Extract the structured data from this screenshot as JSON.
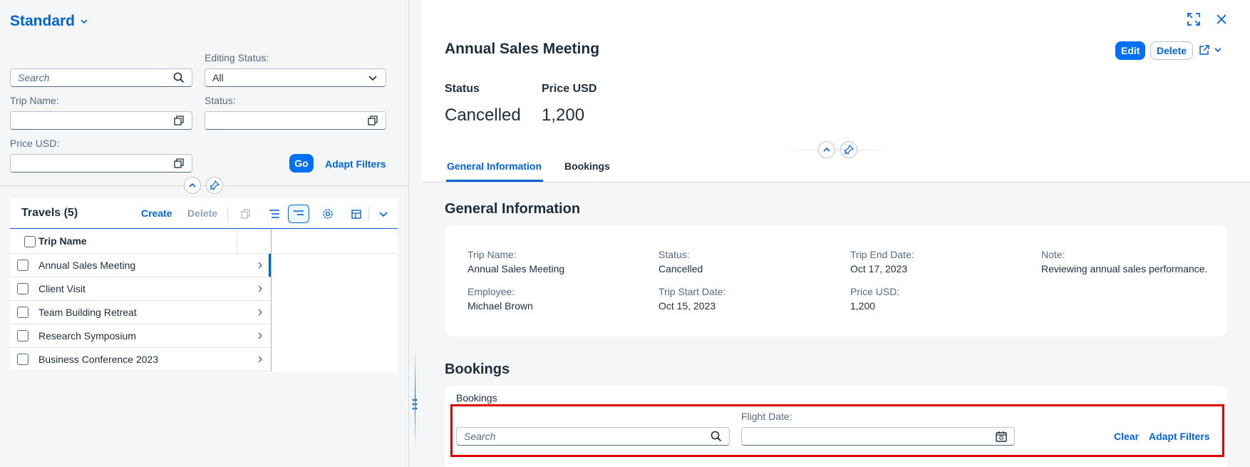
{
  "left": {
    "variant_title": "Standard",
    "filters": {
      "search_placeholder": "Search",
      "editing_status_label": "Editing Status:",
      "editing_status_value": "All",
      "trip_name_label": "Trip Name:",
      "status_label": "Status:",
      "price_label": "Price USD:",
      "go_label": "Go",
      "adapt_filters_label": "Adapt Filters"
    },
    "table": {
      "title": "Travels (5)",
      "create_label": "Create",
      "delete_label": "Delete",
      "column_header": "Trip Name",
      "rows": [
        "Annual Sales Meeting",
        "Client Visit",
        "Team Building Retreat",
        "Research Symposium",
        "Business Conference 2023"
      ]
    }
  },
  "right": {
    "object_title": "Annual Sales Meeting",
    "edit_label": "Edit",
    "delete_label": "Delete",
    "kpis": [
      {
        "label": "Status",
        "value": "Cancelled"
      },
      {
        "label": "Price USD",
        "value": "1,200"
      }
    ],
    "tabs": [
      "General Information",
      "Bookings"
    ],
    "general_info": {
      "title": "General Information",
      "fields": [
        {
          "label": "Trip Name:",
          "value": "Annual Sales Meeting"
        },
        {
          "label": "Status:",
          "value": "Cancelled"
        },
        {
          "label": "Trip End Date:",
          "value": "Oct 17, 2023"
        },
        {
          "label": "Note:",
          "value": "Reviewing annual sales performance."
        },
        {
          "label": "Employee:",
          "value": "Michael Brown"
        },
        {
          "label": "Trip Start Date:",
          "value": "Oct 15, 2023"
        },
        {
          "label": "Price USD:",
          "value": "1,200"
        }
      ]
    },
    "bookings": {
      "section_title": "Bookings",
      "card_title": "Bookings",
      "search_placeholder": "Search",
      "flight_date_label": "Flight Date:",
      "clear_label": "Clear",
      "adapt_filters_label": "Adapt Filters"
    }
  },
  "colors": {
    "brand": "#0070f2",
    "link": "#0064d9",
    "highlight": "#e00000"
  }
}
